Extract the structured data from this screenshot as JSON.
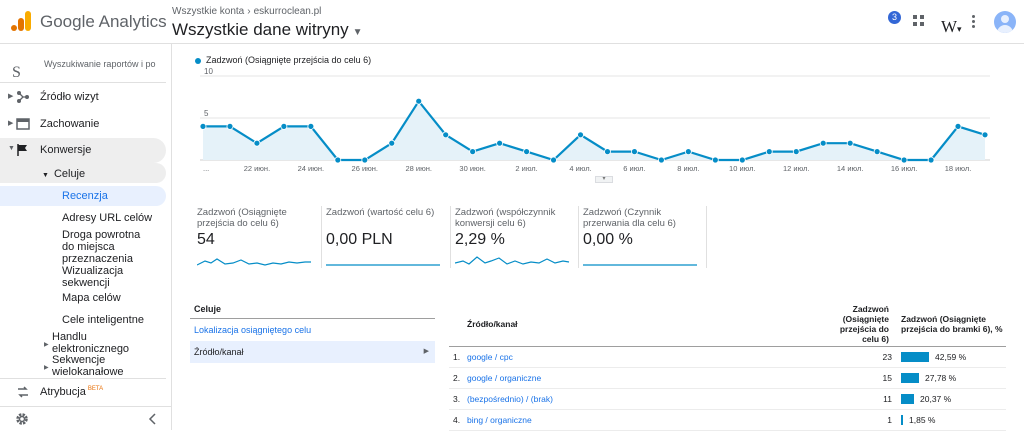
{
  "app": {
    "name": "Google Analytics"
  },
  "header": {
    "breadcrumb_root": "Wszystkie konta",
    "breadcrumb_sep": "›",
    "breadcrumb_property": "eskurroclean.pl",
    "view_name": "Wszystkie dane witryny",
    "notification_count": "3",
    "w_logo": "W",
    "w_logo_caret": "▾"
  },
  "sidebar": {
    "search_glyph": "S",
    "search_placeholder": "Wyszukiwanie raportów i po",
    "items": [
      {
        "label": "Źródło wizyt",
        "icon": "acquisition-icon"
      },
      {
        "label": "Zachowanie",
        "icon": "behavior-icon"
      },
      {
        "label": "Konwersje",
        "icon": "flag-icon"
      }
    ],
    "sub_group": "Celuje",
    "sub_items": [
      "Recenzja",
      "Adresy URL celów",
      "Droga powrotna do miejsca przeznaczenia",
      "Wizualizacja sekwencji",
      "Mapa celów",
      "Cele inteligentne"
    ],
    "collapsed_items": [
      "Handlu elektronicznego",
      "Sekwencje wielokanałowe"
    ],
    "attribution_label": "Atrybucja",
    "attribution_badge": "BETA"
  },
  "chart": {
    "legend_label": "Zadzwoń (Osiągnięte przejścia do celu 6)",
    "ytick_top": "10",
    "ytick_mid": "5",
    "xticks": [
      "...",
      "22 июн.",
      "24 июн.",
      "26 июн.",
      "28 июн.",
      "30 июн.",
      "2 июл.",
      "4 июл.",
      "6 июл.",
      "8 июл.",
      "10 июл.",
      "12 июл.",
      "14 июл.",
      "16 июл.",
      "18 июл."
    ]
  },
  "chart_data": {
    "type": "area",
    "title": "",
    "series": [
      {
        "name": "Zadzwoń (Osiągnięte przejścia do celu 6)",
        "values": [
          4,
          4,
          2,
          4,
          4,
          0,
          0,
          2,
          7,
          3,
          1,
          2,
          1,
          0,
          3,
          1,
          1,
          0,
          1,
          0,
          0,
          1,
          1,
          2,
          2,
          1,
          0,
          0,
          4,
          3
        ]
      }
    ],
    "ylim": [
      0,
      10
    ],
    "grid": true,
    "color": "#058dc7"
  },
  "metrics": [
    {
      "label": "Zadzwoń (Osiągnięte przejścia do celu 6)",
      "value": "54"
    },
    {
      "label": "Zadzwoń (wartość celu 6)",
      "value": "0,00 PLN"
    },
    {
      "label": "Zadzwoń (współczynnik konwersji celu 6)",
      "value": "2,29 %"
    },
    {
      "label": "Zadzwoń (Czynnik przerwania dla celu 6)",
      "value": "0,00 %"
    }
  ],
  "goals_panel": {
    "header": "Celuje",
    "link": "Lokalizacja osiągniętego celu",
    "selected": "Źródło/kanał"
  },
  "table": {
    "col_source": "Źródło/kanał",
    "col_count": "Zadzwoń (Osiągnięte przejścia do celu 6)",
    "col_pct": "Zadzwoń (Osiągnięte przejścia do bramki 6), %",
    "rows": [
      {
        "idx": "1.",
        "source": "google / cpc",
        "count": "23",
        "pct": "42,59 %",
        "frac": 0.4259
      },
      {
        "idx": "2.",
        "source": "google / organiczne",
        "count": "15",
        "pct": "27,78 %",
        "frac": 0.2778
      },
      {
        "idx": "3.",
        "source": "(bezpośrednio) / (brak)",
        "count": "11",
        "pct": "20,37 %",
        "frac": 0.2037
      },
      {
        "idx": "4.",
        "source": "bing / organiczne",
        "count": "1",
        "pct": "1,85 %",
        "frac": 0.0185
      }
    ]
  }
}
